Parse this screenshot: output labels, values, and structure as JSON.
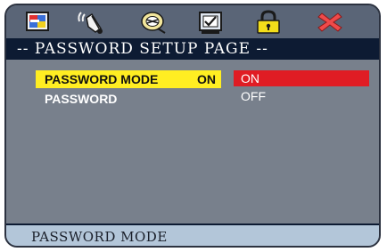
{
  "icon_bar": {
    "icons": [
      {
        "name": "display-setup-icon",
        "active": false
      },
      {
        "name": "audio-setup-icon",
        "active": false
      },
      {
        "name": "disc-setup-icon",
        "active": false
      },
      {
        "name": "preference-checkbox-icon",
        "active": false
      },
      {
        "name": "lock-icon",
        "active": true
      },
      {
        "name": "exit-x-icon",
        "active": false
      }
    ]
  },
  "page": {
    "title": "-- PASSWORD SETUP PAGE --"
  },
  "menu": {
    "items": [
      {
        "label": "PASSWORD MODE",
        "value": "ON",
        "selected": true
      },
      {
        "label": "PASSWORD",
        "value": ""
      }
    ],
    "options": [
      {
        "label": "ON",
        "selected": true
      },
      {
        "label": "OFF",
        "selected": false
      }
    ]
  },
  "status": {
    "text": "PASSWORD MODE"
  },
  "colors": {
    "title_bg": "#0d1b33",
    "content_bg": "#78808c",
    "icon_bar_bg": "#5a6577",
    "highlight": "#ffee22",
    "option_selected": "#e01c24",
    "status_bg": "#b3c6d9"
  }
}
